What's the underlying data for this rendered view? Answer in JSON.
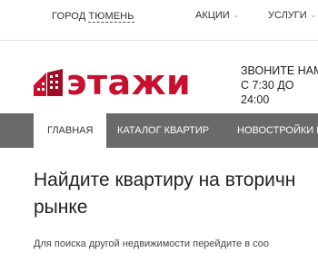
{
  "topbar": {
    "city_prefix": "ГОРОД",
    "city_name": "ТЮМЕНЬ",
    "menu": [
      {
        "label": "АКЦИИ"
      },
      {
        "label": "УСЛУГИ"
      }
    ]
  },
  "logo": {
    "text": "этажи",
    "brand_color": "#c8102e"
  },
  "contact": {
    "line1": "ЗВОНИТЕ НАМ",
    "line2": "С 7:30 ДО",
    "line3": "24:00"
  },
  "mainnav": {
    "items": [
      {
        "label": "ГЛАВНАЯ"
      },
      {
        "label": "КАТАЛОГ КВАРТИР"
      },
      {
        "label": "НОВОСТРОЙКИ В"
      }
    ]
  },
  "content": {
    "heading_line1": "Найдите квартиру на вторичн",
    "heading_line2": "рынке",
    "subtext": "Для поиска другой недвижимости перейдите в соо"
  }
}
